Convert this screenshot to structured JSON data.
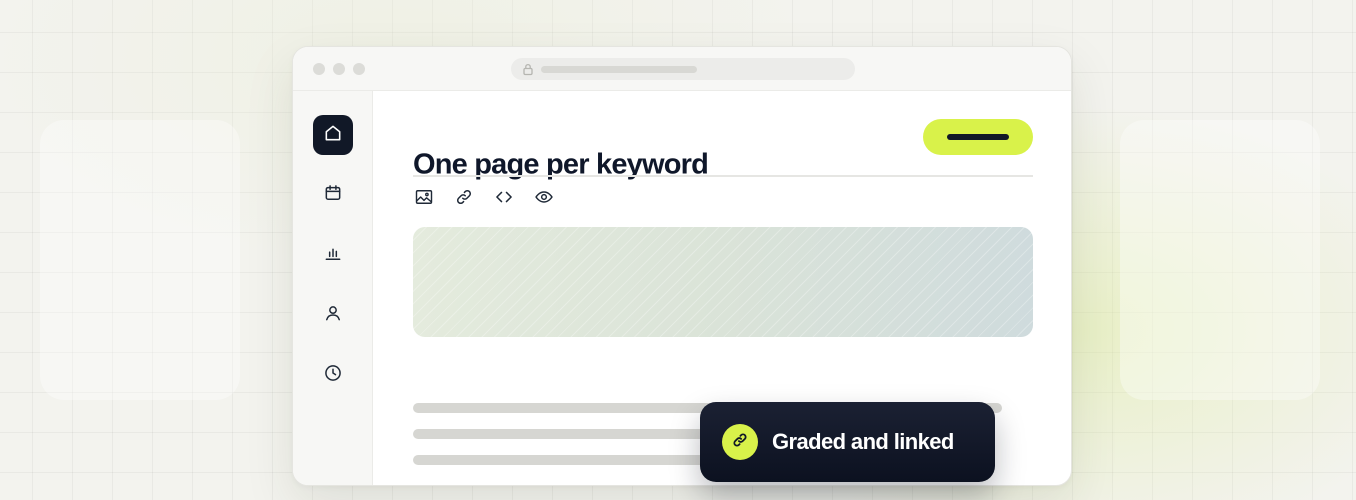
{
  "page": {
    "title": "One page per keyword"
  },
  "sidebar": {
    "items": [
      {
        "icon": "home-icon",
        "active": true
      },
      {
        "icon": "calendar-icon",
        "active": false
      },
      {
        "icon": "bar-chart-icon",
        "active": false
      },
      {
        "icon": "user-icon",
        "active": false
      },
      {
        "icon": "clock-icon",
        "active": false
      }
    ]
  },
  "toolbar": {
    "icons": [
      "image-icon",
      "link-icon",
      "code-icon",
      "eye-icon"
    ]
  },
  "toast": {
    "label": "Graded and linked",
    "icon": "link-icon"
  },
  "colors": {
    "accent": "#d9f24a",
    "dark": "#111827",
    "toast_bg": "#0f1424"
  }
}
